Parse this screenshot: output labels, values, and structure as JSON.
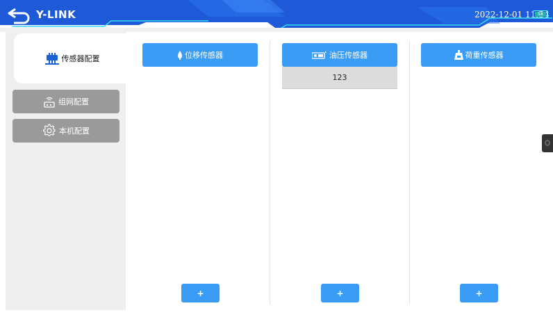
{
  "header": {
    "logo_text": "Y-LINK",
    "datetime": "2022-12-01 11:34",
    "battery_label": "58",
    "colors": {
      "bar": "#1e5ad8",
      "accent": "#38d9f0",
      "battery": "#27b1ad"
    }
  },
  "sidebar": {
    "items": [
      {
        "label": "传感器配置",
        "icon": "sensor-board-icon",
        "active": true
      },
      {
        "label": "组网配置",
        "icon": "router-icon",
        "active": false
      },
      {
        "label": "本机配置",
        "icon": "gear-icon",
        "active": false
      }
    ]
  },
  "main": {
    "columns": [
      {
        "title": "位移传感器",
        "icon": "displacement-sensor-icon",
        "rows": [],
        "add_label": "+"
      },
      {
        "title": "油压传感器",
        "icon": "oil-pressure-sensor-icon",
        "rows": [
          "123"
        ],
        "add_label": "+"
      },
      {
        "title": "荷重传感器",
        "icon": "load-sensor-icon",
        "rows": [],
        "add_label": "+"
      }
    ],
    "colors": {
      "primary": "#3a9cf5",
      "row_bg": "#dcdcdc",
      "sidebar_bg": "#efefef",
      "inactive_button": "#9a9a9a"
    }
  }
}
